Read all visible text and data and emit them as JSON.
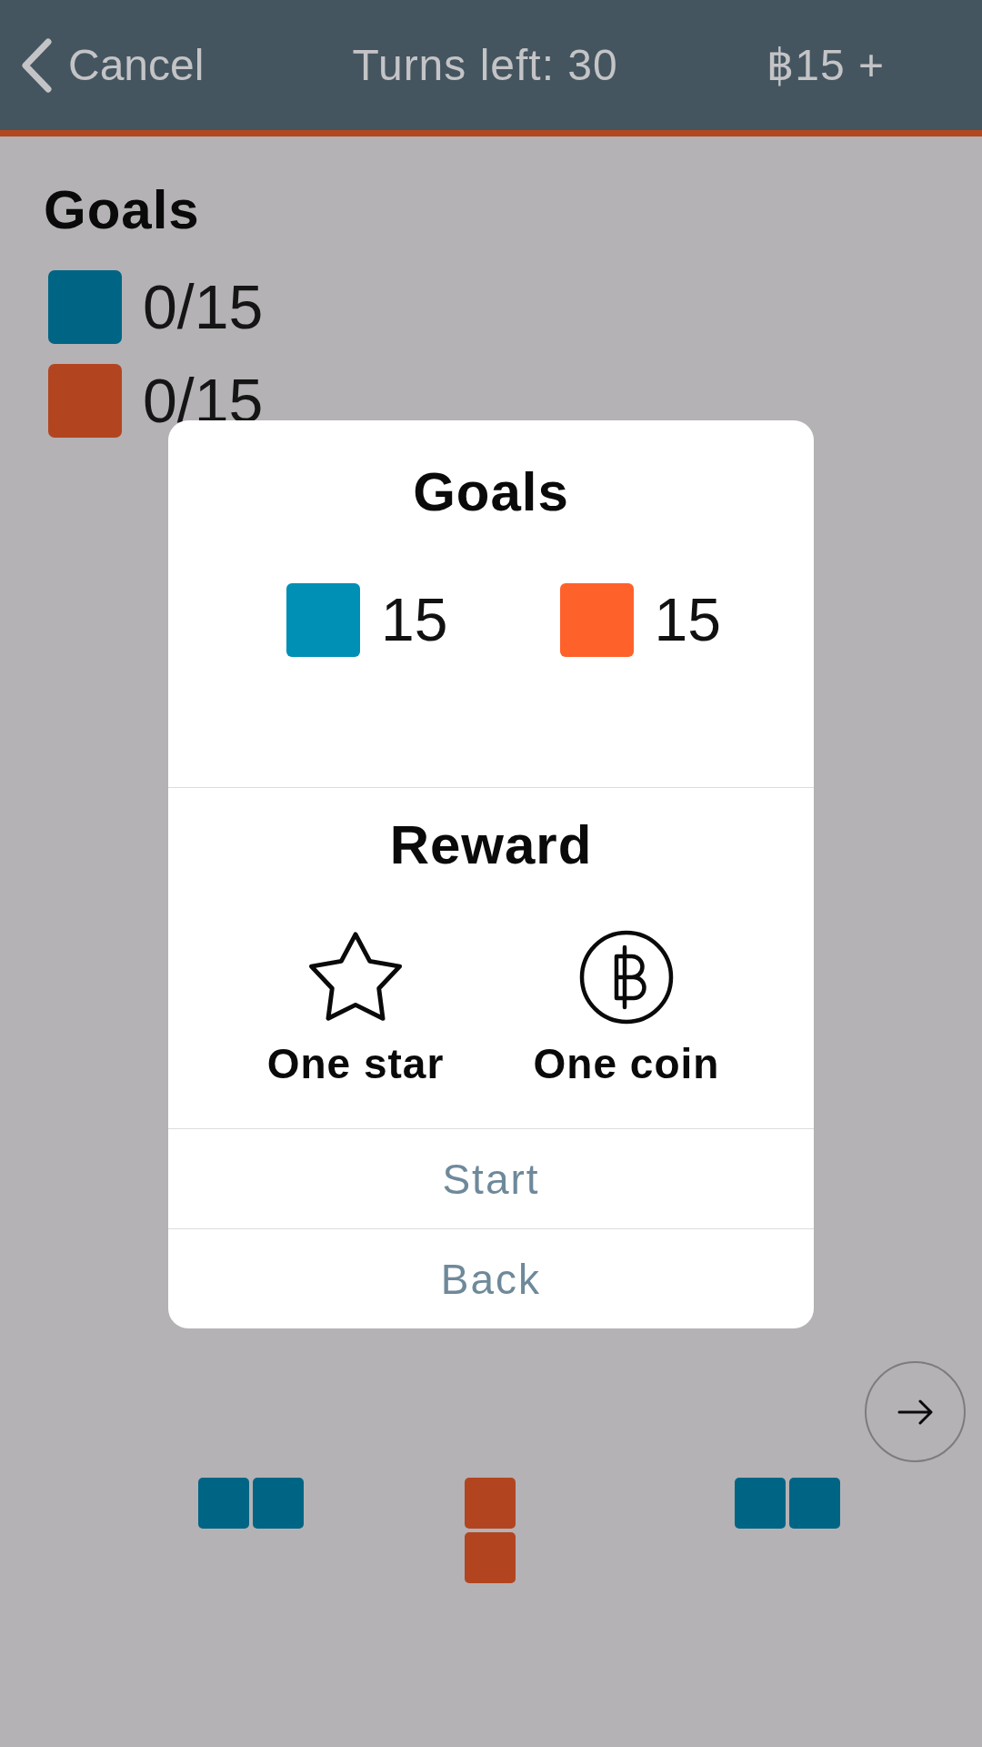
{
  "nav_bar": {
    "back_label": "Cancel",
    "title": "Turns left: 30",
    "balance": "฿15 +"
  },
  "goals": {
    "title": "Goals",
    "items": [
      {
        "color": "#006585",
        "progress": "0/15"
      },
      {
        "color": "#b24520",
        "progress": "0/15"
      }
    ]
  },
  "pieces": [
    {
      "kind": "horizontal",
      "color": "#006585"
    },
    {
      "kind": "vertical",
      "color": "#b24520"
    },
    {
      "kind": "horizontal",
      "color": "#006585"
    }
  ],
  "dialog": {
    "title": "Goals",
    "goals": [
      {
        "color": "#0090b5",
        "count": "15"
      },
      {
        "color": "#ff612b",
        "count": "15"
      }
    ],
    "reward_title": "Reward",
    "rewards": [
      {
        "kind": "star",
        "label": "One star"
      },
      {
        "kind": "coin",
        "label": "One coin"
      }
    ],
    "buttons": [
      "Start",
      "Back"
    ]
  }
}
